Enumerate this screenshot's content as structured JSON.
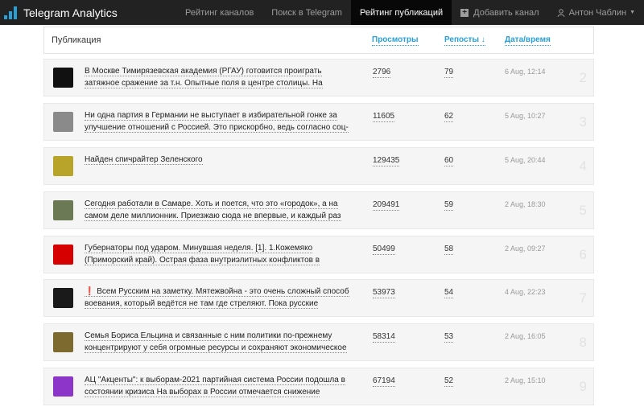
{
  "brand": {
    "title": "Telegram Analytics"
  },
  "nav": {
    "channel_rating": "Рейтинг каналов",
    "search": "Поиск в Telegram",
    "pub_rating": "Рейтинг публикаций",
    "add_channel": "Добавить канал",
    "user": "Антон Чаблин"
  },
  "table": {
    "col_pub": "Публикация",
    "col_views": "Просмотры",
    "col_reposts": "Репосты ↓",
    "col_date": "Дата/время"
  },
  "rows": [
    {
      "text": "В Москве Тимирязевская академия (РГАУ) готовится проиграть затяжное сражение за т.н. Опытные поля в центре столицы. На",
      "views": "2796",
      "reposts": "79",
      "date": "6 Aug, 12:14",
      "rank": "2"
    },
    {
      "text": "Ни одна партия в Германии не выступает в избирательной гонке за улучшение отношений с Россией. Это прискорбно, ведь согласно соц-",
      "views": "11605",
      "reposts": "62",
      "date": "5 Aug, 10:27",
      "rank": "3"
    },
    {
      "text": "Найден спичрайтер Зеленского",
      "views": "129435",
      "reposts": "60",
      "date": "5 Aug, 20:44",
      "rank": "4"
    },
    {
      "text": "Сегодня работали в Самаре. Хоть и поется, что это «городок», а на самом деле миллионник. Приезжаю сюда не впервые, и каждый раз",
      "views": "209491",
      "reposts": "59",
      "date": "2 Aug, 18:30",
      "rank": "5"
    },
    {
      "text": "Губернаторы под ударом. Минувшая неделя. [1]. 1.Кожемяко (Приморский край). Острая фаза внутриэлитных конфликтов в регионе",
      "views": "50499",
      "reposts": "58",
      "date": "2 Aug, 09:27",
      "rank": "6"
    },
    {
      "text": "❗ Всем Русским на заметку. Мятежвойна - это очень сложный способ воевания, который ведётся не там где стреляют. Пока русские",
      "views": "53973",
      "reposts": "54",
      "date": "4 Aug, 22:23",
      "rank": "7"
    },
    {
      "text": "Семья Бориса Ельцина и связанные с ним политики по-прежнему концентрируют у себя огромные ресурсы и сохраняют экономическое",
      "views": "58314",
      "reposts": "53",
      "date": "2 Aug, 16:05",
      "rank": "8"
    },
    {
      "text": "АЦ \"Акценты\": к выборам-2021 партийная система России подошла в состоянии кризиса На выборах в России отмечается снижение",
      "views": "67194",
      "reposts": "52",
      "date": "2 Aug, 15:10",
      "rank": "9"
    }
  ],
  "thumb_colors": [
    "#111111",
    "#8a8a8a",
    "#b9a42a",
    "#6b7a55",
    "#d60000",
    "#1a1a1a",
    "#7d6a2e",
    "#8c35c9"
  ],
  "accent": "#2a9fd6"
}
